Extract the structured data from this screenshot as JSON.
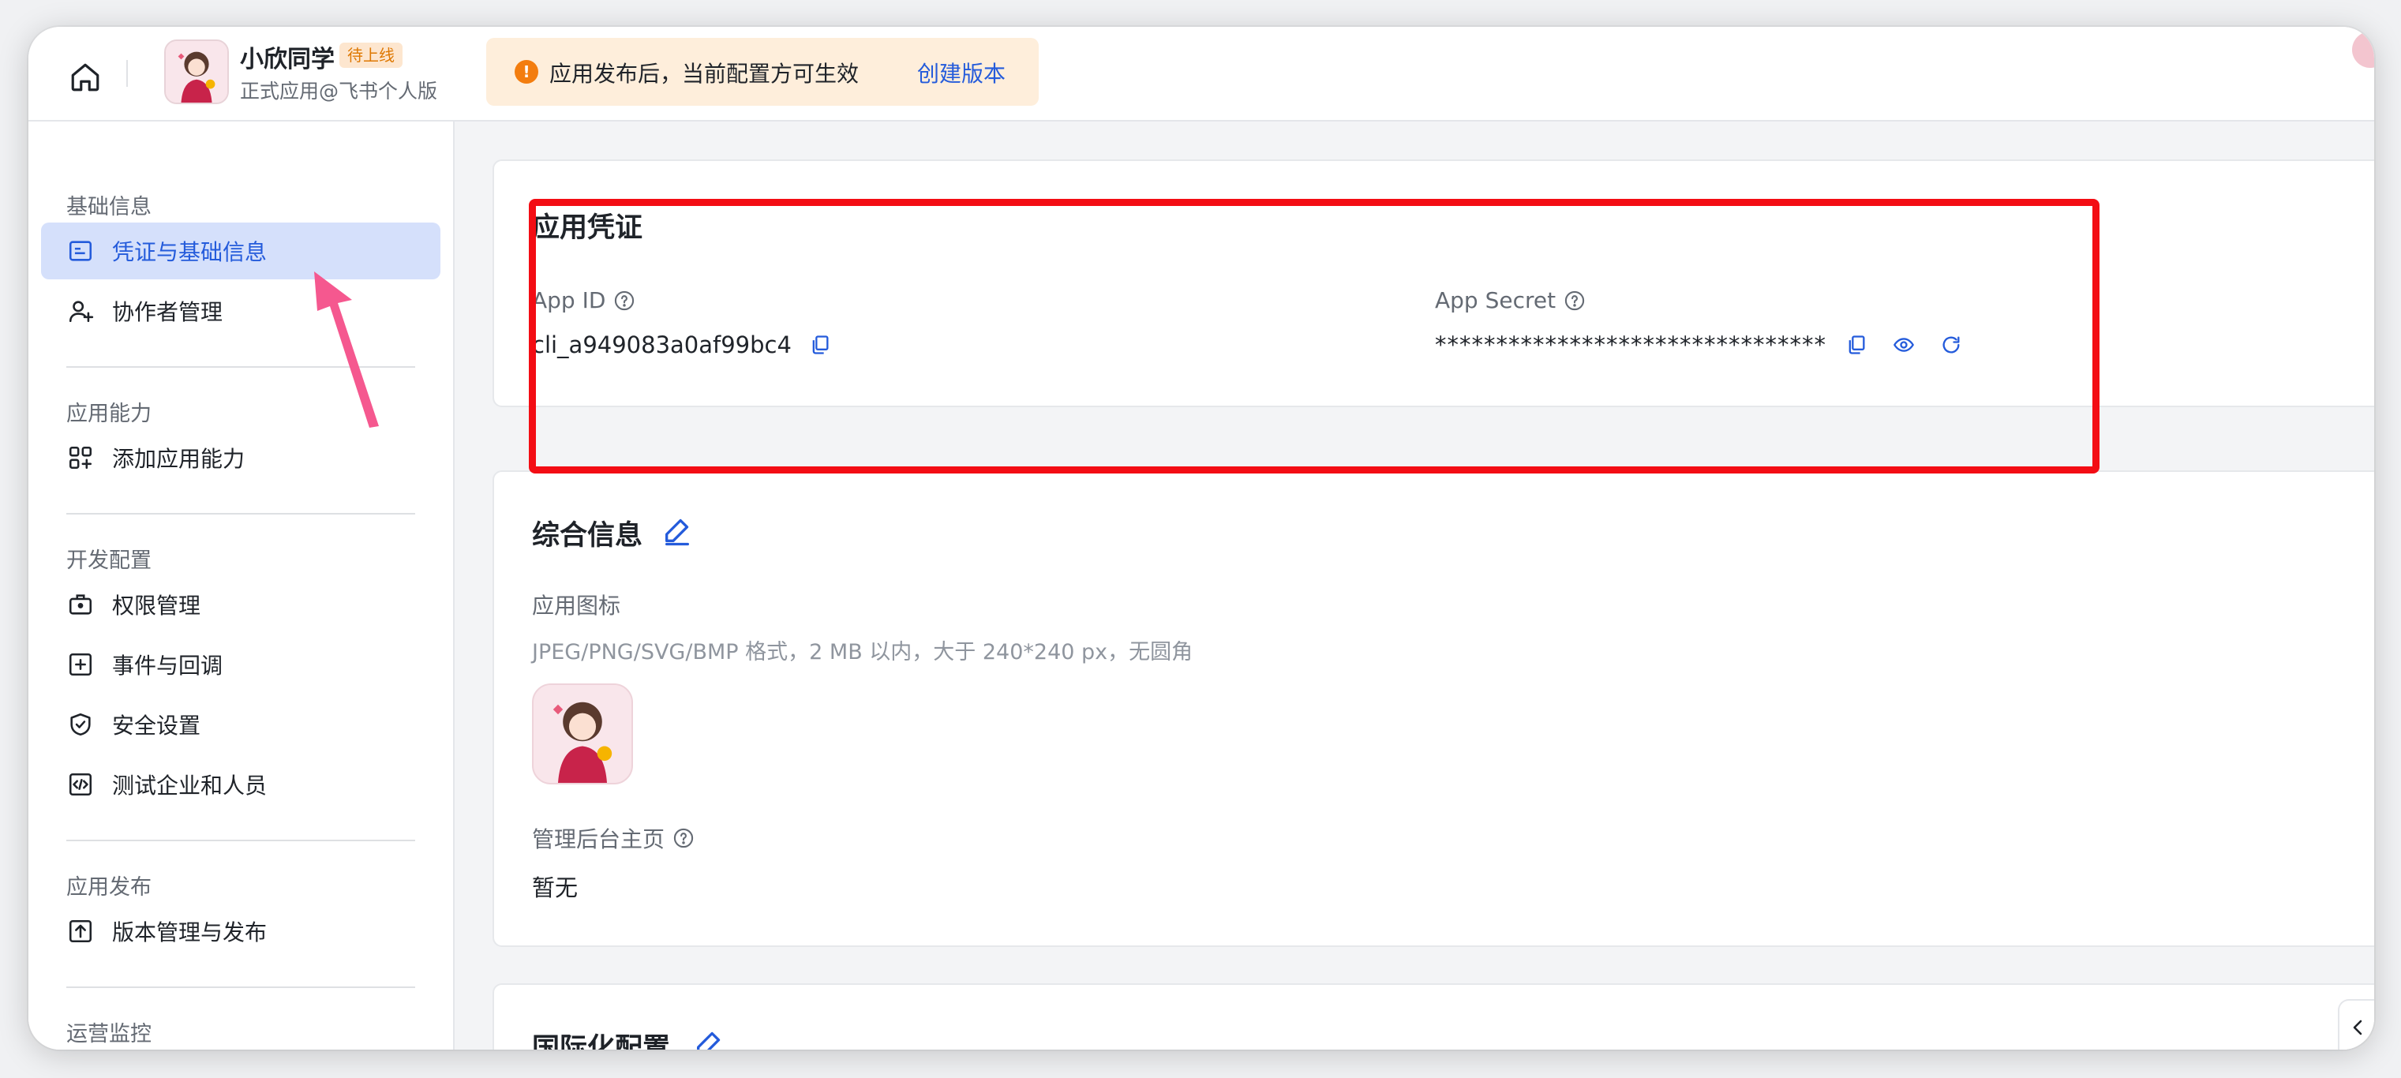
{
  "header": {
    "app_name": "小欣同学",
    "status_badge": "待上线",
    "app_subtitle": "正式应用@飞书个人版",
    "notice": {
      "text": "应用发布后，当前配置方可生效",
      "link": "创建版本"
    }
  },
  "sidebar": {
    "sections": [
      {
        "title": "基础信息",
        "items": [
          {
            "label": "凭证与基础信息",
            "icon": "id-card-icon",
            "active": true
          },
          {
            "label": "协作者管理",
            "icon": "user-add-icon"
          }
        ]
      },
      {
        "title": "应用能力",
        "items": [
          {
            "label": "添加应用能力",
            "icon": "grid-add-icon"
          }
        ]
      },
      {
        "title": "开发配置",
        "items": [
          {
            "label": "权限管理",
            "icon": "briefcase-icon"
          },
          {
            "label": "事件与回调",
            "icon": "event-add-icon"
          },
          {
            "label": "安全设置",
            "icon": "shield-icon"
          },
          {
            "label": "测试企业和人员",
            "icon": "code-icon"
          }
        ]
      },
      {
        "title": "应用发布",
        "items": [
          {
            "label": "版本管理与发布",
            "icon": "upload-icon"
          }
        ]
      },
      {
        "title": "运营监控",
        "items": []
      }
    ]
  },
  "credentials": {
    "title": "应用凭证",
    "app_id_label": "App ID",
    "app_id_value": "cli_a949083a0af99bc4",
    "app_secret_label": "App Secret",
    "app_secret_value": "********************************"
  },
  "general_info": {
    "title": "综合信息",
    "icon_label": "应用图标",
    "icon_hint": "JPEG/PNG/SVG/BMP 格式，2 MB 以内，大于 240*240 px，无圆角",
    "admin_home_label": "管理后台主页",
    "admin_home_value": "暂无"
  },
  "i18n": {
    "title": "国际化配置"
  },
  "expand_tab": {
    "label": "展"
  },
  "colors": {
    "accent": "#245bdb",
    "active_bg": "#d5e0fb",
    "highlight": "#f30d14",
    "badge_bg": "#fde6cf",
    "notice_bg": "#feeedb"
  }
}
